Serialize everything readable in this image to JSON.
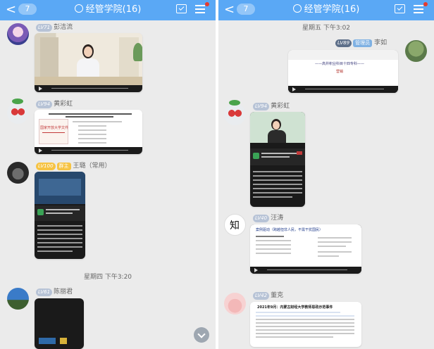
{
  "header": {
    "back_label": "<",
    "unread_count": "7",
    "title": "经管学院(16)"
  },
  "left": {
    "messages": [
      {
        "level": "LV71",
        "role": "",
        "name": "彭洁流"
      },
      {
        "level": "LV94",
        "role": "",
        "name": "黄彩虹"
      },
      {
        "level": "LV100",
        "role": "群主",
        "name": "王璐（常用）"
      },
      {
        "level": "LV61",
        "role": "",
        "name": "陈丽君"
      }
    ],
    "timestamp": "星期四 下午3:20",
    "doc_slide_title": "国家开放大学文件"
  },
  "right": {
    "timestamp": "星期五 下午3:02",
    "messages": [
      {
        "level": "LV89",
        "role": "管理员",
        "name": "李如"
      },
      {
        "level": "LV94",
        "role": "",
        "name": "黄彩虹"
      },
      {
        "level": "LV40",
        "role": "",
        "name": "汪涛"
      },
      {
        "level": "LV42",
        "role": "",
        "name": "董克"
      }
    ],
    "slide_lines": [
      "——高并积业科目十四专科——",
      "营销"
    ],
    "slide2_title": "案例驱动（跨越但非人民，不需干扰国民）",
    "slide3_title": "2021年9月：内蒙古财经大学教师思政示范事件"
  },
  "colors": {
    "header_bg": "#5aa8f5",
    "chat_bg": "#ebebeb",
    "level_badge": "#b7c3d6",
    "owner_badge": "#f6c343",
    "admin_badge": "#7fb1e3"
  }
}
